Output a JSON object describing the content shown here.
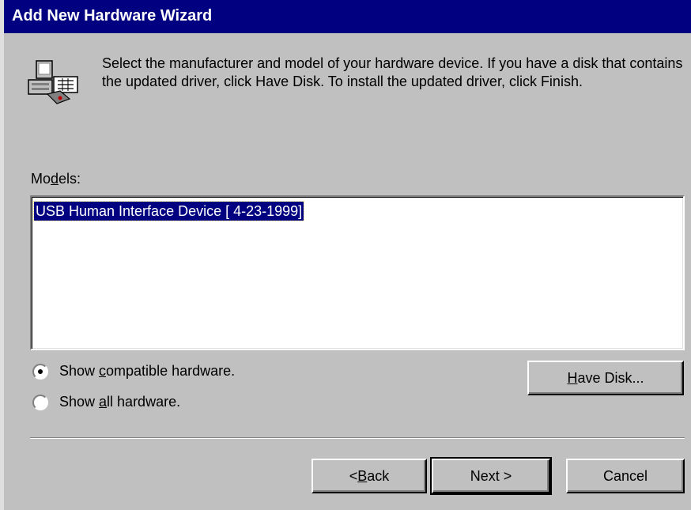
{
  "window": {
    "title": "Add New Hardware Wizard"
  },
  "icon": {
    "name": "hardware-computer-icon"
  },
  "instructions": "Select the manufacturer and model of your hardware device. If you have a disk that contains the updated driver, click Have Disk. To install the updated driver, click Finish.",
  "models": {
    "label_pre": "Mo",
    "label_accel": "d",
    "label_post": "els:",
    "items": [
      "USB Human Interface Device [ 4-23-1999]"
    ],
    "selected_index": 0
  },
  "options": {
    "compatible": {
      "pre": "Show ",
      "accel": "c",
      "post": "ompatible hardware.",
      "checked": true
    },
    "all": {
      "pre": "Show ",
      "accel": "a",
      "post": "ll hardware.",
      "checked": false
    }
  },
  "buttons": {
    "have_disk": {
      "accel": "H",
      "rest": "ave Disk..."
    },
    "back": {
      "pre": "< ",
      "accel": "B",
      "rest": "ack"
    },
    "next": "Next >",
    "cancel": "Cancel"
  },
  "colors": {
    "title_bar": "#000080",
    "face": "#c0c0c0",
    "selection": "#000080"
  }
}
